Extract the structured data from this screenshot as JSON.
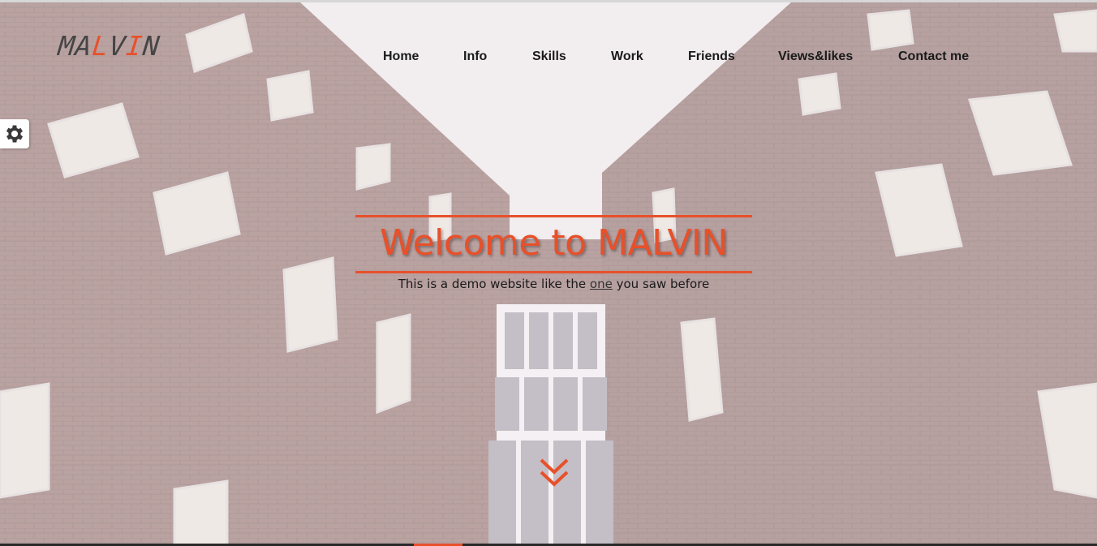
{
  "logo": {
    "part1": "MA",
    "accent1": "L",
    "part2": "V",
    "accent2": "I",
    "part3": "N"
  },
  "nav": {
    "items": [
      {
        "label": "Home"
      },
      {
        "label": "Info"
      },
      {
        "label": "Skills"
      },
      {
        "label": "Work"
      },
      {
        "label": "Friends"
      },
      {
        "label": "Views&likes"
      },
      {
        "label": "Contact me"
      }
    ]
  },
  "hero": {
    "title": "Welcome to MALVIN",
    "subtitle_before": "This is a demo website like the ",
    "subtitle_link": "one",
    "subtitle_after": " you saw before"
  },
  "icons": {
    "settings": "gear-icon",
    "scroll": "double-chevron-down-icon"
  },
  "colors": {
    "accent": "#e8502a",
    "nav_text": "#1a1a1a",
    "brick": "#7a4a44",
    "sky": "#f2eef0"
  }
}
